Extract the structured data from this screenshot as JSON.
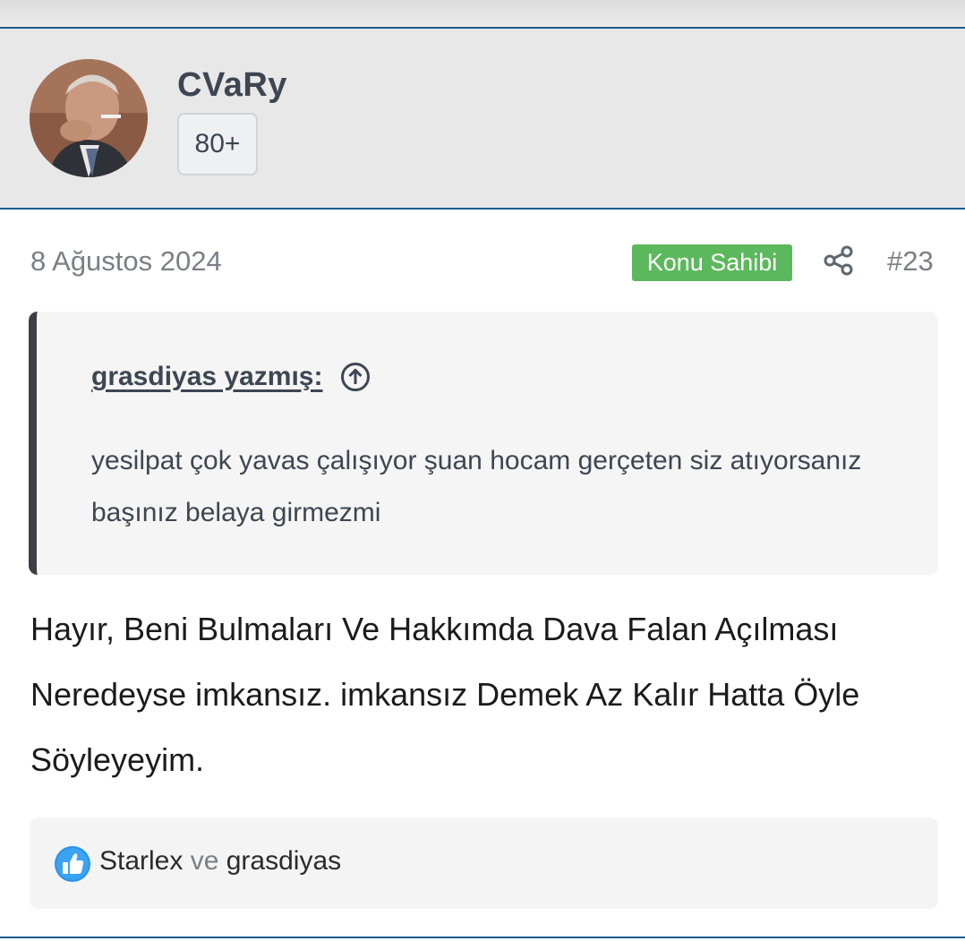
{
  "user": {
    "name": "CVaRy",
    "badge": "80+"
  },
  "post": {
    "date": "8 Ağustos 2024",
    "owner_badge": "Konu Sahibi",
    "number": "#23",
    "message": "Hayır, Beni Bulmaları Ve Hakkımda Dava Falan Açılması Neredeyse imkansız. imkansız Demek Az Kalır Hatta Öyle Söyleyeyim."
  },
  "quote": {
    "author": "grasdiyas yazmış:",
    "text": "yesilpat çok yavas çalışıyor şuan hocam gerçeten siz atıyorsanız başınız belaya girmezmi"
  },
  "reactions": {
    "user1": "Starlex",
    "connector": "ve",
    "user2": "grasdiyas"
  },
  "colors": {
    "accent": "#1f5a8c",
    "owner_badge": "#5cb85c",
    "like_icon": "#2a93e8"
  },
  "icons": {
    "share": "share-icon",
    "quote_jump": "arrow-up-circle-icon",
    "like": "thumbs-up-icon"
  }
}
